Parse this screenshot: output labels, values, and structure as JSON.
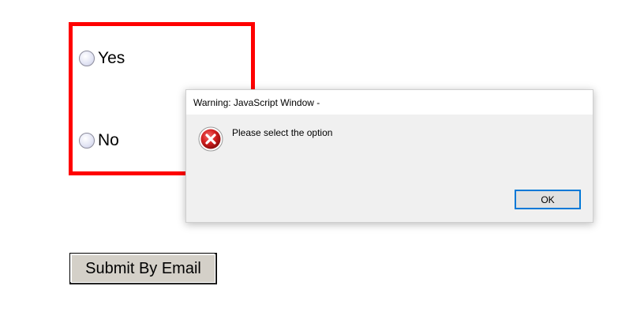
{
  "form": {
    "options": [
      {
        "label": "Yes",
        "selected": false
      },
      {
        "label": "No",
        "selected": false
      }
    ],
    "validation_border_color": "#ff0000",
    "submit_label": "Submit By Email"
  },
  "dialog": {
    "title": "Warning: JavaScript Window -",
    "message": "Please select the option",
    "icon": "error-icon",
    "ok_label": "OK",
    "accent_color": "#0078d7"
  }
}
